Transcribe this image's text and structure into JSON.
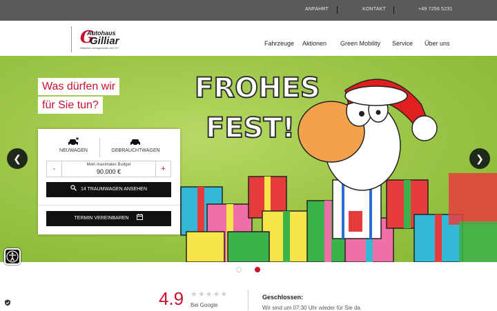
{
  "topbar": {
    "links": [
      "ANFAHRT",
      "KONTAKT",
      "+49 7256 5231"
    ]
  },
  "logo": {
    "line1": "Autohaus",
    "line2": "Gilliar",
    "tagline": "Mitsubishi-Vertragshändler seit 1977"
  },
  "nav": {
    "items": [
      "Fahrzeuge",
      "Aktionen",
      "Green Mobility",
      "Service",
      "Über uns"
    ]
  },
  "hero": {
    "question_line1": "Was dürfen wir",
    "question_line2": "für Sie tun?",
    "greeting_line1": "FROHES",
    "greeting_line2": "FEST!"
  },
  "search_panel": {
    "tabs": [
      {
        "label": "NEUWAGEN",
        "icon": "car-new-icon"
      },
      {
        "label": "GEBRAUCHTWAGEN",
        "icon": "car-icon"
      }
    ],
    "budget_caption": "Mein maximales Budget",
    "budget_value": "90.000 €",
    "minus_label": "-",
    "plus_label": "+",
    "search_button": "14 TRAUMWAGEN ANSEHEN",
    "appointment_button": "TERMIN VEREINBAREN"
  },
  "slider": {
    "prev_icon": "chevron-left-icon",
    "next_icon": "chevron-right-icon",
    "slide_count": 2,
    "active_slide": 2
  },
  "rating": {
    "value": "4.9",
    "stars": "★★★★★",
    "source": "Bei Google"
  },
  "status": {
    "title": "Geschlossen:",
    "text": "Wir sind um 07:30 Uhr wieder für Sie da."
  },
  "colors": {
    "accent": "#c8102e",
    "topbar": "#5a5a5a",
    "hero_green": "#9ec74a"
  }
}
